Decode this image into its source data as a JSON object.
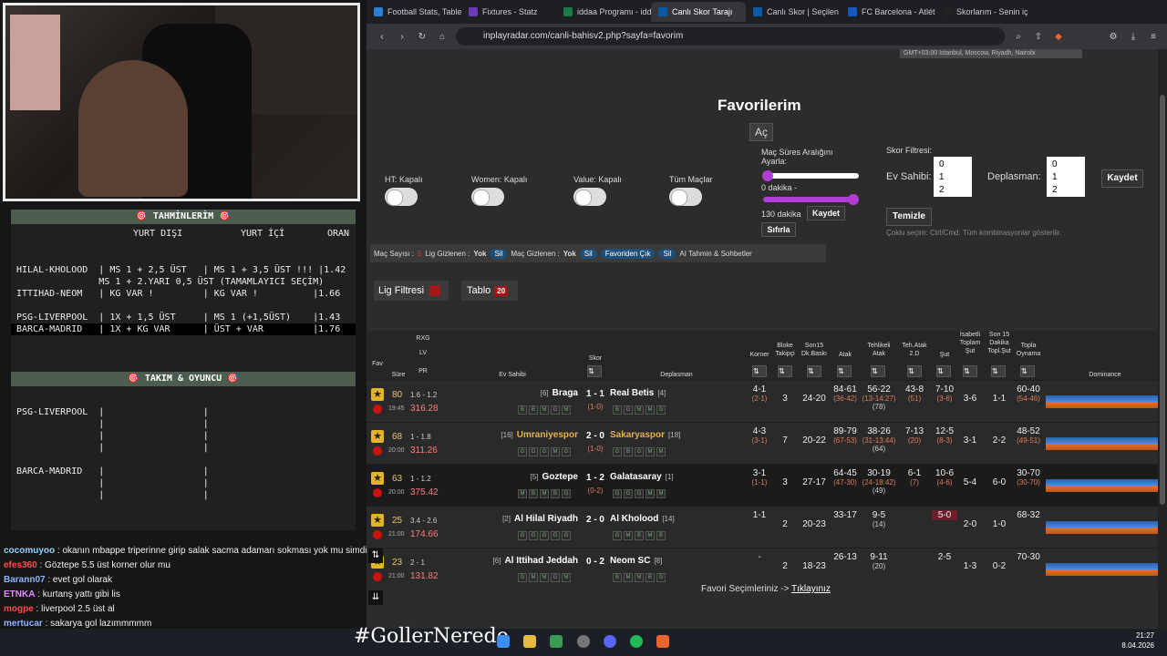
{
  "predictions": {
    "header": "🎯  TAHMİNLERİM  🎯",
    "col_abroad": "YURT DIŞI",
    "col_home": "YURT İÇİ",
    "col_odds": "ORAN",
    "lines": [
      "HILAL-KHOLOOD  | MS 1 + 2,5 ÜST   | MS 1 + 3,5 ÜST !!! |1.42",
      "               MS 1 + 2.YARI 0,5 ÜST (TAMAMLAYICI SEÇİM)",
      "ITTIHAD-NEOM   | KG VAR !         | KG VAR !          |1.66",
      "",
      "PSG-LIVERPOOL  | 1X + 1,5 ÜST     | MS 1 (+1,5ÜST)    |1.43",
      "BARCA-MADRID   | 1X + KG VAR      | ÜST + VAR         |1.76"
    ],
    "section2": "🎯  TAKIM & OYUNCU  🎯",
    "lines2": [
      "PSG-LIVERPOOL  |                  |",
      "               |                  |",
      "               |                  |",
      "               |                  |",
      "",
      "BARCA-MADRID   |                  |",
      "               |                  |",
      "               |                  |"
    ]
  },
  "chat": [
    {
      "user": "cocomuyoo",
      "color": "#8fd4ff",
      "msg": "okanın mbappe triperinne girip salak sacma adamarı sokması yok mu simdi"
    },
    {
      "user": "efes360",
      "color": "#ff4c4c",
      "msg": "Göztepe 5.5 üst korner olur mu"
    },
    {
      "user": "Barann07",
      "color": "#8fb4ff",
      "msg": "evet gol olarak"
    },
    {
      "user": "ETNKA",
      "color": "#e38cff",
      "msg": "kurtanş yattı gibi lis"
    },
    {
      "user": "mogpe",
      "color": "#ff4c4c",
      "msg": "liverpool 2.5 üst al"
    },
    {
      "user": "mertucar",
      "color": "#8fb4ff",
      "msg": "sakarya gol lazımmmmm"
    }
  ],
  "browser": {
    "tabs": [
      "Football Stats, Table",
      "Fixtures - Statz",
      "iddaa Programı - idd",
      "Canlı Skor Tarajı",
      "Canlı Skor | Seçilen",
      "FC Barcelona - Atlét",
      "Skorlarım - Senin iç"
    ],
    "active_tab": 3,
    "url": "inplayradar.com/canli-bahisv2.php?sayfa=favorim"
  },
  "page": {
    "timezone": "GMT+03:00 Istanbul, Moscow, Riyadh, Nairobi",
    "title": "Favorilerim",
    "open_btn": "Aç",
    "toggles": [
      "HT: Kapalı",
      "Women: Kapalı",
      "Value: Kapalı",
      "Tüm Maçlar"
    ],
    "range_label": "Maç Süres Aralığını Ayarla:",
    "range_min": "0 dakika -",
    "range_max": "130 dakika",
    "save": "Kaydet",
    "reset": "Sıfırla",
    "score_filter": "Skor Filtresi:",
    "home_label": "Ev Sahibi:",
    "away_label": "Deplasman:",
    "home_opts": [
      "0",
      "1",
      "2"
    ],
    "away_opts": [
      "0",
      "1",
      "2"
    ],
    "clear": "Temizle",
    "multi_hint": "Çoklu seçim: Ctrl/Cmd. Tüm kombinasyonlar gösterilir.",
    "filter_bar": {
      "mac_sayisi": "Maç Sayısı :",
      "mac_count": "5",
      "lig_gizlenen": "Lig Gizlenen :",
      "lig_val": "Yok",
      "sil": "Sil",
      "mac_gizlenen": "Maç Gizlenen :",
      "mac_val": "Yok",
      "favori_cik": "Favoriden Çık",
      "ai": "AI Tahmin & Sohbetler"
    },
    "lig_filter": "Lig Filtresi",
    "tablo": "Tablo",
    "tablo_count": "20",
    "fav_link_text": "Favori Seçimleriniz ->",
    "fav_link": "Tıklayınız"
  },
  "table": {
    "headers": {
      "fav": "Fav",
      "sure": "Süre",
      "rxg": "RXG",
      "lv": "LV",
      "pr": "PR",
      "home": "Ev Sahibi",
      "skor": "Skor",
      "away": "Deplasman",
      "korner": "Korner",
      "bloke": "Bloke Takipçi",
      "son15": "Son15 Dk.Baskı",
      "atak": "Atak",
      "tehlikeli": "Tehlikeli Atak",
      "teh_atak": "Teh.Atak 2.D",
      "sut": "Şut",
      "isabetli": "İsabetli Toplam Şut",
      "son15dk": "Son 15 Dakika Topl.Şut",
      "topla": "Topla Oynama",
      "dominance": "Dominance"
    },
    "rows": [
      {
        "min": "80",
        "time": "19:45",
        "rxg": "1.6 - 1.2",
        "lv": "316.28",
        "home_pre": "AS",
        "home_rank": "[6]",
        "home": "Braga",
        "home_card": "3",
        "score": "1 - 1",
        "ht": "(1-0)",
        "away": "Real Betis",
        "away_rank": "[4]",
        "away_card": "3",
        "home_form": [
          "B",
          "B",
          "M",
          "G",
          "M"
        ],
        "away_form": [
          "B",
          "G",
          "M",
          "M",
          "G"
        ],
        "korner": "4-1",
        "korner_ht": "(2-1)",
        "bloke": "3",
        "son15": "24-20",
        "atak": "84-61",
        "atak_ht": "(36-42)",
        "teh": "56-22",
        "teh_ht": "(13-14:27)",
        "teh_2": "(78)",
        "teh2": "43-8",
        "teh2_s": "(51)",
        "sut": "7-10",
        "sut_s": "(3-6)",
        "isabet": "3-6",
        "son15dk": "1-1",
        "topla": "60-40",
        "topla_s": "(54-46)",
        "dark": false,
        "orange": false
      },
      {
        "min": "68",
        "time": "20:00",
        "rxg": "1 - 1.8",
        "lv": "311.26",
        "home_pre": "IO",
        "home_rank": "[16]",
        "home": "Umraniyespor",
        "home_card": "",
        "score": "2 - 0",
        "ht": "(1-0)",
        "away": "Sakaryaspor",
        "away_rank": "[18]",
        "away_card": "1",
        "home_form": [
          "G",
          "G",
          "G",
          "M",
          "G"
        ],
        "away_form": [
          "G",
          "B",
          "G",
          "M",
          "M"
        ],
        "korner": "4-3",
        "korner_ht": "(3-1)",
        "bloke": "7",
        "son15": "20-22",
        "atak": "89-79",
        "atak_ht": "(67-53)",
        "teh": "38-26",
        "teh_ht": "(31-13:44)",
        "teh_2": "(64)",
        "teh2": "7-13",
        "teh2_s": "(20)",
        "sut": "12-5",
        "sut_s": "(8-3)",
        "isabet": "3-1",
        "son15dk": "2-2",
        "topla": "48-52",
        "topla_s": "(49-51)",
        "dark": false,
        "orange": true
      },
      {
        "min": "63",
        "time": "20:00",
        "rxg": "1 - 1.2",
        "lv": "375.42",
        "home_pre": "IO",
        "home_rank": "[5]",
        "home": "Goztepe",
        "home_card": "",
        "score": "1 - 2",
        "ht": "(0-2)",
        "away": "Galatasaray",
        "away_rank": "[1]",
        "away_card": "",
        "home_form": [
          "M",
          "B",
          "M",
          "B",
          "G"
        ],
        "away_form": [
          "G",
          "G",
          "G",
          "M",
          "M"
        ],
        "korner": "3-1",
        "korner_ht": "(1-1)",
        "bloke": "3",
        "son15": "27-17",
        "atak": "64-45",
        "atak_ht": "(47-30)",
        "teh": "30-19",
        "teh_ht": "(24-18:42)",
        "teh_2": "(49)",
        "teh2": "6-1",
        "teh2_s": "(7)",
        "sut": "10-6",
        "sut_s": "(4-6)",
        "isabet": "5-4",
        "son15dk": "6-0",
        "topla": "30-70",
        "topla_s": "(30-70)",
        "dark": true,
        "orange": false
      },
      {
        "min": "25",
        "time": "21:00",
        "rxg": "3.4 - 2.6",
        "lv": "174.66",
        "home_pre": "IO",
        "home_rank": "[2]",
        "home": "Al Hilal Riyadh",
        "home_card": "",
        "score": "2 - 0",
        "ht": "",
        "away": "Al Kholood",
        "away_rank": "[14]",
        "away_card": "1",
        "home_form": [
          "G",
          "G",
          "G",
          "G",
          "G"
        ],
        "away_form": [
          "G",
          "M",
          "B",
          "M",
          "B"
        ],
        "korner": "1-1",
        "korner_ht": "",
        "bloke": "2",
        "son15": "20-23",
        "atak": "33-17",
        "atak_ht": "",
        "teh": "9-5",
        "teh_ht": "",
        "teh_2": "(14)",
        "teh2": "",
        "teh2_s": "",
        "sut": "5-0",
        "sut_s": "",
        "isabet": "2-0",
        "son15dk": "1-0",
        "topla": "68-32",
        "topla_s": "",
        "dark": false,
        "orange": false
      },
      {
        "min": "23",
        "time": "21:00",
        "rxg": "2 - 1",
        "lv": "131.82",
        "home_pre": "1",
        "home_rank": "[6]",
        "home": "Al Ittihad Jeddah",
        "home_card": "",
        "score": "0 - 2",
        "ht": "",
        "away": "Neom SC",
        "away_rank": "[8]",
        "away_card": "",
        "home_form": [
          "G",
          "M",
          "M",
          "G",
          "M"
        ],
        "away_form": [
          "B",
          "M",
          "M",
          "B",
          "G"
        ],
        "korner": "-",
        "korner_ht": "",
        "bloke": "2",
        "son15": "18-23",
        "atak": "26-13",
        "atak_ht": "",
        "teh": "9-11",
        "teh_ht": "",
        "teh_2": "(20)",
        "teh2": "",
        "teh2_s": "",
        "sut": "2-5",
        "sut_s": "",
        "isabet": "1-3",
        "son15dk": "0-2",
        "topla": "70-30",
        "topla_s": "",
        "dark": false,
        "orange": false
      }
    ]
  },
  "taskbar": {
    "hashtag": "#GollerNerede",
    "time": "21:27",
    "date": "8.04.2026"
  }
}
